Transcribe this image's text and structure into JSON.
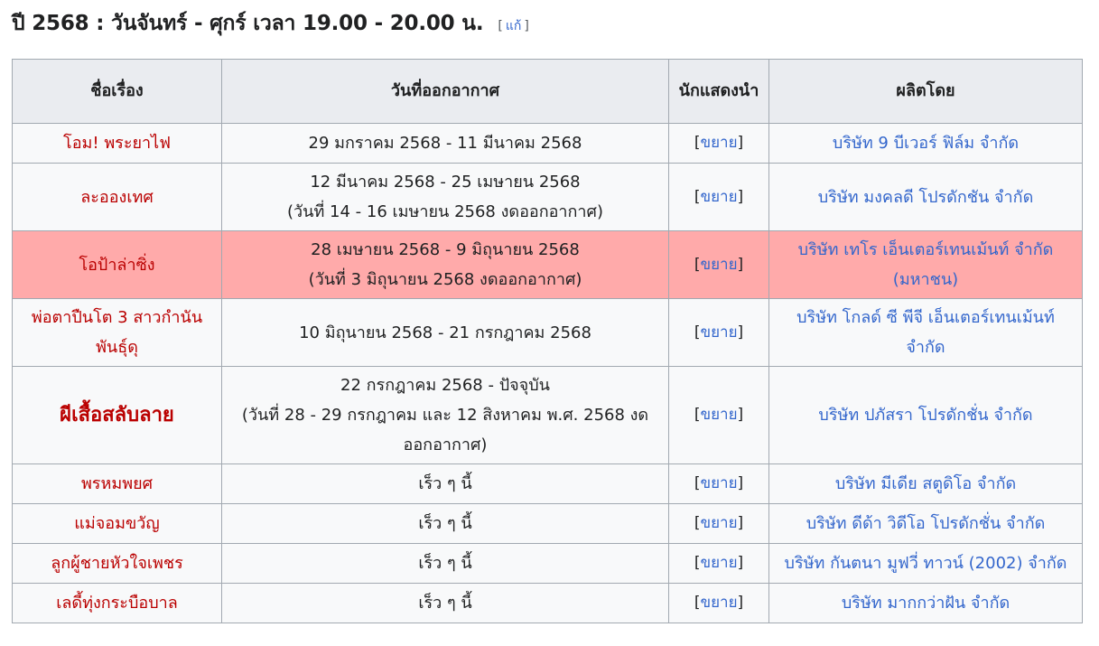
{
  "heading": "ปี 2568 : วันจันทร์ - ศุกร์ เวลา 19.00 - 20.00 น.",
  "edit_open": "[",
  "edit_label": "แก้",
  "edit_close": "]",
  "columns": [
    "ชื่อเรื่อง",
    "วันที่ออกอากาศ",
    "นักแสดงนำ",
    "ผลิตโดย"
  ],
  "expand_label": "ขยาย",
  "rows": [
    {
      "title": "โอม! พระยาไฟ",
      "dates": "29 มกราคม 2568 - 11 มีนาคม 2568",
      "note": "",
      "producer": "บริษัท 9 บีเวอร์ ฟิล์ม จำกัด"
    },
    {
      "title": "ละอองเทศ",
      "dates": "12 มีนาคม 2568 - 25 เมษายน 2568",
      "note": "(วันที่ 14 - 16 เมษายน 2568 งดออกอากาศ)",
      "producer": "บริษัท มงคลดี โปรดักชัน จำกัด"
    },
    {
      "title": "โอป้าล่าซิ่ง",
      "dates": "28 เมษายน 2568 - 9 มิถุนายน 2568",
      "note": "(วันที่ 3 มิถุนายน 2568 งดออกอากาศ)",
      "producer": "บริษัท เทโร เอ็นเตอร์เทนเม้นท์ จำกัด (มหาชน)"
    },
    {
      "title": "พ่อตาปืนโต 3 สาวกำนันพันธุ์ดุ",
      "dates": "10 มิถุนายน 2568 - 21 กรกฎาคม 2568",
      "note": "",
      "producer": "บริษัท โกลด์ ซี พีจี เอ็นเตอร์เทนเม้นท์ จำกัด"
    },
    {
      "title": "ผีเสื้อสลับลาย",
      "dates": "22 กรกฎาคม 2568 - ปัจจุบัน",
      "note": "(วันที่ 28 - 29 กรกฎาคม และ 12 สิงหาคม พ.ศ. 2568 งดออกอากาศ)",
      "producer": "บริษัท ปภัสรา โปรดักชั่น จำกัด"
    },
    {
      "title": "พรหมพยศ",
      "dates": "เร็ว ๆ นี้",
      "note": "",
      "producer": "บริษัท มีเดีย สตูดิโอ จำกัด"
    },
    {
      "title": "แม่จอมขวัญ",
      "dates": "เร็ว ๆ นี้",
      "note": "",
      "producer": "บริษัท ดีด้า วิดีโอ โปรดักชั่น จำกัด"
    },
    {
      "title": "ลูกผู้ชายหัวใจเพชร",
      "dates": "เร็ว ๆ นี้",
      "note": "",
      "producer": "บริษัท กันตนา มูฟวี่ ทาวน์ (2002) จำกัด"
    },
    {
      "title": "เลดี้ทุ่งกระบือบาล",
      "dates": "เร็ว ๆ นี้",
      "note": "",
      "producer": "บริษัท มากกว่าฝัน จำกัด"
    }
  ]
}
